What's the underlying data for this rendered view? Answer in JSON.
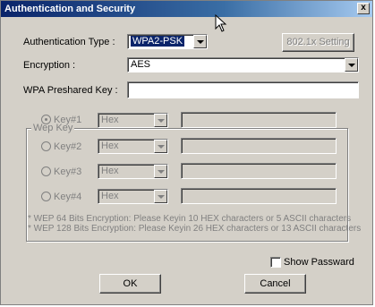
{
  "window": {
    "title": "Authentication and Security",
    "close_glyph": "x"
  },
  "auth": {
    "label": "Authentication Type :",
    "value": "WPA2-PSK"
  },
  "button_8021x": "802.1x Setting",
  "encryption": {
    "label": "Encryption :",
    "value": "AES"
  },
  "psk": {
    "label": "WPA Preshared Key :",
    "value": ""
  },
  "wep": {
    "group_title": "Wep Key",
    "keys": [
      {
        "label": "Key#1",
        "format": "Hex",
        "value": "",
        "selected": true
      },
      {
        "label": "Key#2",
        "format": "Hex",
        "value": "",
        "selected": false
      },
      {
        "label": "Key#3",
        "format": "Hex",
        "value": "",
        "selected": false
      },
      {
        "label": "Key#4",
        "format": "Hex",
        "value": "",
        "selected": false
      }
    ],
    "note1": "* WEP 64 Bits Encryption:  Please Keyin 10 HEX characters or 5 ASCII characters",
    "note2": "* WEP 128 Bits Encryption:  Please Keyin 26 HEX characters or 13 ASCII characters"
  },
  "show_password": {
    "label": "Show Passward",
    "checked": false
  },
  "buttons": {
    "ok": "OK",
    "cancel": "Cancel"
  }
}
